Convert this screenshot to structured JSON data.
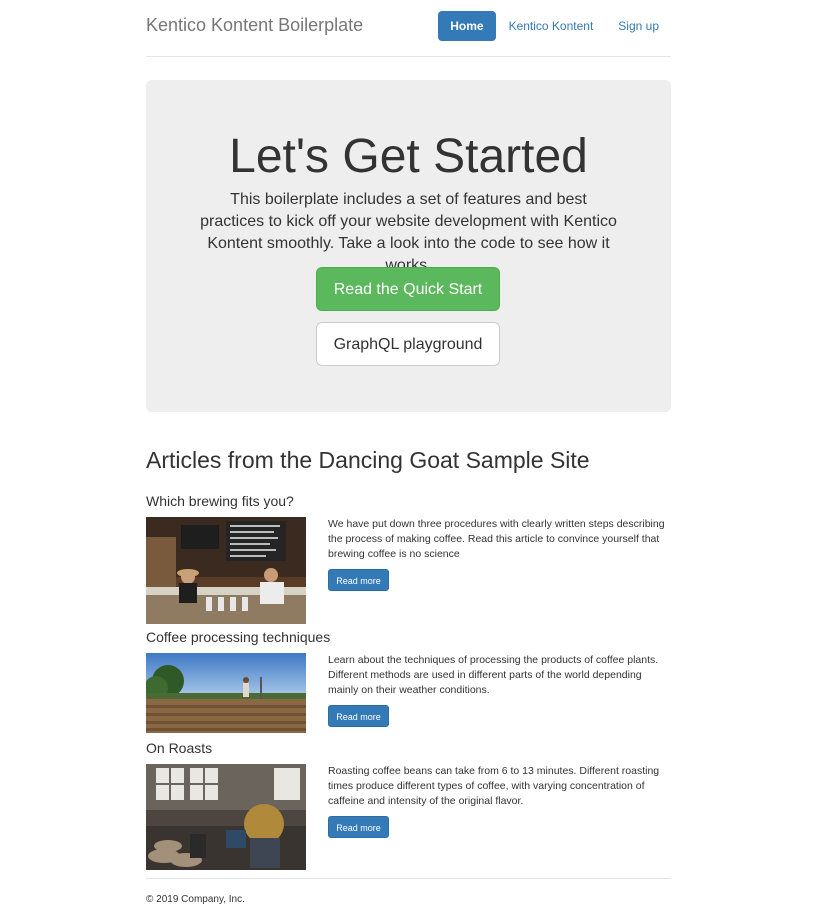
{
  "header": {
    "brand": "Kentico Kontent Boilerplate",
    "nav": [
      {
        "label": "Home",
        "active": true
      },
      {
        "label": "Kentico Kontent",
        "active": false
      },
      {
        "label": "Sign up",
        "active": false
      }
    ]
  },
  "jumbotron": {
    "title": "Let's Get Started",
    "text": "This boilerplate includes a set of features and best practices to kick off your website development with Kentico Kontent smoothly. Take a look into the code to see how it works.",
    "primary_button": "Read the Quick Start",
    "secondary_button": "GraphQL playground"
  },
  "articles_section": {
    "title": "Articles from the Dancing Goat Sample Site",
    "items": [
      {
        "title": "Which brewing fits you?",
        "summary": "We have put down three procedures with clearly written steps describing the process of making coffee. Read this article to convince yourself that brewing coffee is no science",
        "button": "Read more"
      },
      {
        "title": "Coffee processing techniques",
        "summary": "Learn about the techniques of processing the products of coffee plants. Different methods are used in different parts of the world depending mainly on their weather conditions.",
        "button": "Read more"
      },
      {
        "title": "On Roasts",
        "summary": "Roasting coffee beans can take from 6 to 13 minutes. Different roasting times produce different types of coffee, with varying concentration of caffeine and intensity of the original flavor.",
        "button": "Read more"
      }
    ]
  },
  "footer": {
    "text": "© 2019 Company, Inc."
  },
  "colors": {
    "primary": "#337ab7",
    "success": "#5cb85c",
    "jumbotron_bg": "#eeeeee"
  }
}
